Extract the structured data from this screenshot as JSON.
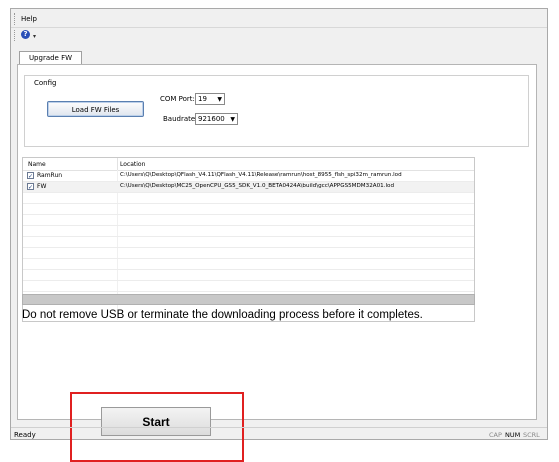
{
  "menu": {
    "help": "Help"
  },
  "toolbar": {
    "help_icon": "question-icon",
    "help_glyph": "?",
    "dropdown_glyph": "▾"
  },
  "tabs": [
    {
      "label": "Upgrade FW"
    }
  ],
  "config": {
    "label": "Config",
    "load_button": "Load FW Files",
    "com_port_label": "COM Port:",
    "com_port_value": "19",
    "baudrate_label": "Baudrate:",
    "baudrate_value": "921600"
  },
  "file_list": {
    "columns": [
      "Name",
      "Location"
    ],
    "rows": [
      {
        "checked": true,
        "name": "RamRun",
        "location": "C:\\Users\\Q\\Desktop\\QFlash_V4.11\\QFlash_V4.11\\Release\\ramrun\\host_8955_flsh_spi32m_ramrun.lod"
      },
      {
        "checked": true,
        "name": "FW",
        "location": "C:\\Users\\Q\\Desktop\\MC25_OpenCPU_GS5_SDK_V1.0_BETA0424A\\build\\gcc\\APPGS5MDM32A01.lod"
      }
    ]
  },
  "progress": {
    "fraction": 0.0
  },
  "warning_text": "Do not remove USB or terminate the downloading process before it completes.",
  "start_button": "Start",
  "status": {
    "text": "Ready",
    "indicators": [
      "CAP",
      "NUM",
      "SCRL"
    ]
  },
  "colors": {
    "highlight": "#e02020",
    "progress_fill": "#3aa13a"
  }
}
